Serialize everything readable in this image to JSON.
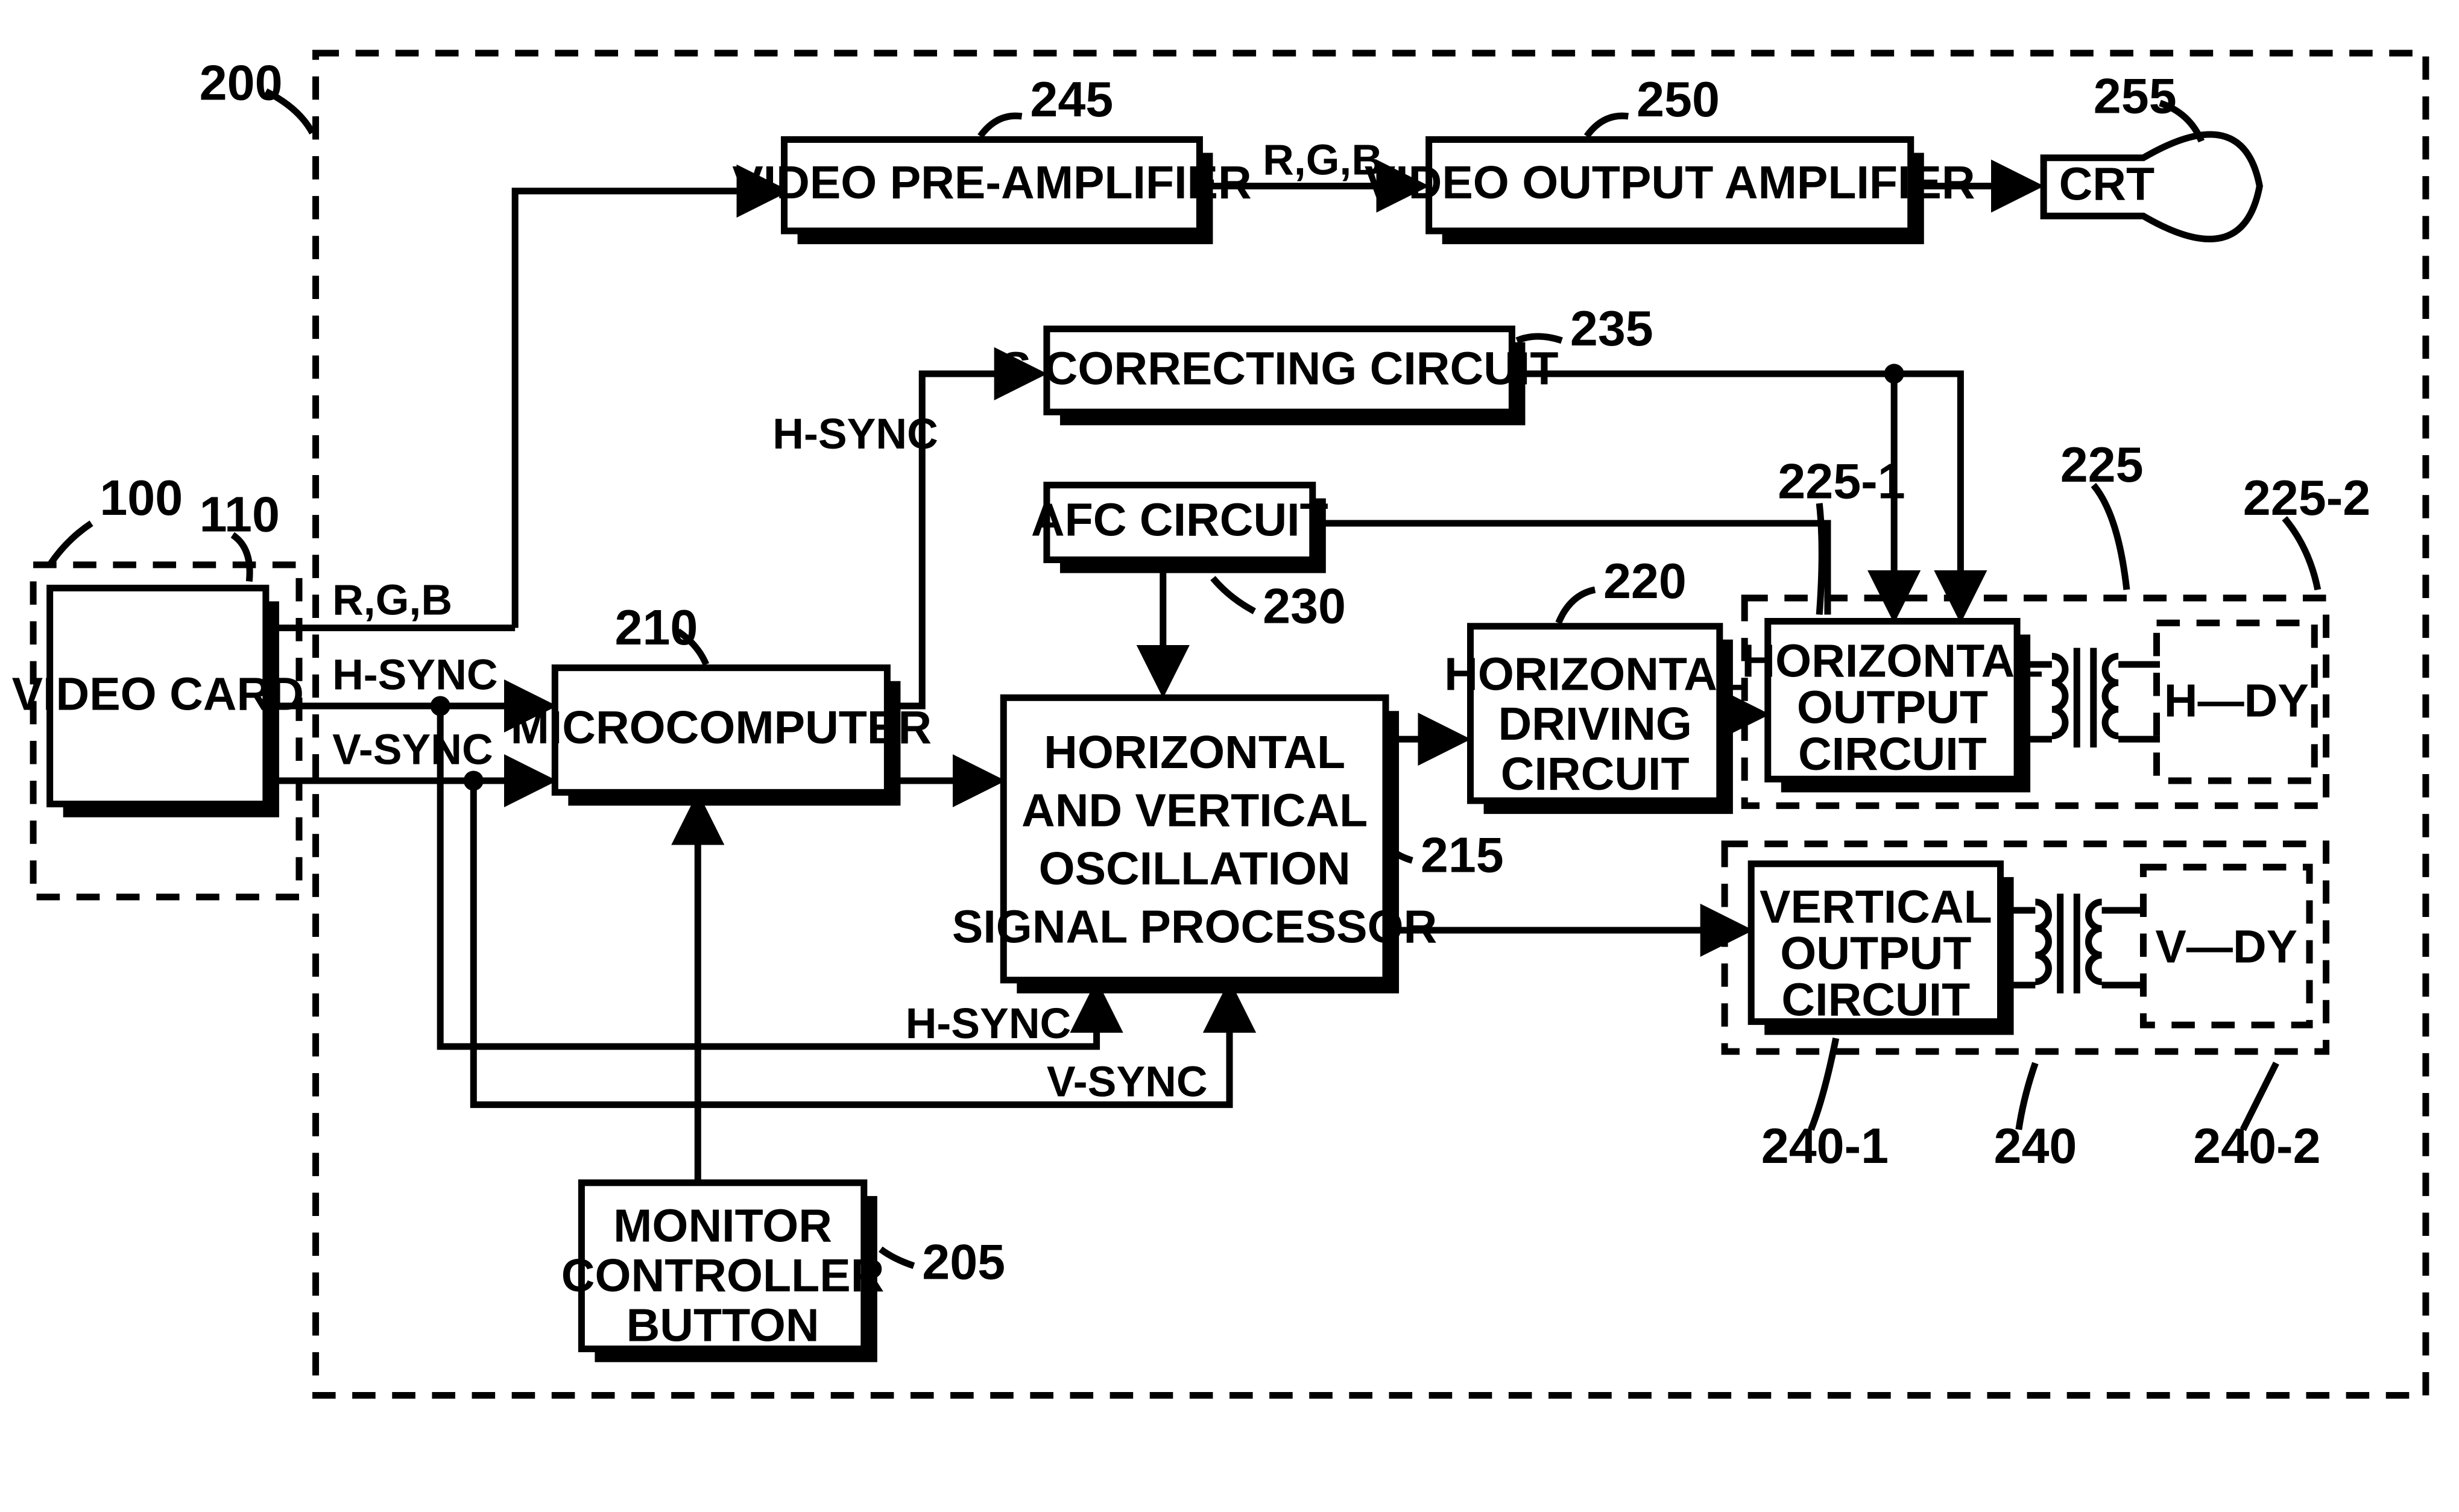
{
  "blocks": {
    "video_card": {
      "label": "VIDEO CARD",
      "ref": "110",
      "group_ref": "100"
    },
    "microcomputer": {
      "label": "MICROCOMPUTER",
      "ref": "210"
    },
    "monitor_btn": {
      "lines": [
        "MONITOR",
        "CONTROLLER",
        "BUTTON"
      ],
      "ref": "205"
    },
    "pre_amp": {
      "label": "VIDEO PRE-AMPLIFIER",
      "ref": "245"
    },
    "out_amp": {
      "label": "VIDEO OUTPUT AMPLIFIER",
      "ref": "250"
    },
    "crt": {
      "label": "CRT",
      "ref": "255"
    },
    "s_corr": {
      "label": "S CORRECTING CIRCUIT",
      "ref": "235"
    },
    "afc": {
      "label": "AFC CIRCUIT",
      "ref": "230"
    },
    "hv_osc": {
      "lines": [
        "HORIZONTAL",
        "AND VERTICAL",
        "OSCILLATION",
        "SIGNAL PROCESSOR"
      ],
      "ref": "215"
    },
    "h_drive": {
      "lines": [
        "HORIZONTAL",
        "DRIVING",
        "CIRCUIT"
      ],
      "ref": "220"
    },
    "h_out": {
      "lines": [
        "HORIZONTAL",
        "OUTPUT",
        "CIRCUIT"
      ],
      "ref": "225-1"
    },
    "v_out": {
      "lines": [
        "VERTICAL",
        "OUTPUT",
        "CIRCUIT"
      ],
      "ref": "240-1"
    },
    "h_dy": {
      "label": "H—DY",
      "ref": "225-2"
    },
    "v_dy": {
      "label": "V—DY",
      "ref": "240-2"
    },
    "h_group": {
      "ref": "225"
    },
    "v_group": {
      "ref": "240"
    },
    "monitor_group": {
      "ref": "200"
    }
  },
  "signals": {
    "rgb": "R,G,B",
    "hsync": "H-SYNC",
    "vsync": "V-SYNC"
  }
}
